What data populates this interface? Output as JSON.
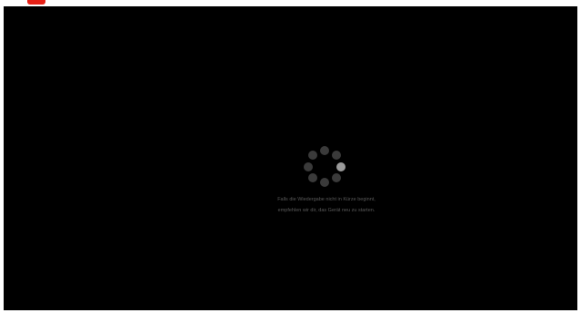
{
  "header": {
    "logo_icon": "youtube-logo-icon",
    "logo_color": "#e62117"
  },
  "player": {
    "background": "#000000",
    "loading_icon": "loading-spinner-icon",
    "message_line1": "Falls die Wiedergabe nicht in Kürze beginnt,",
    "message_line2": "empfehlen wir dir, das Gerät neu zu starten."
  }
}
